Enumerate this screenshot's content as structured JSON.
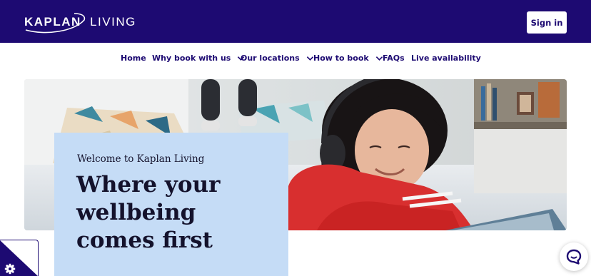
{
  "header": {
    "logo": {
      "primary": "KAPLAN",
      "secondary": "LIVING",
      "icon": "kaplan-swoosh-logo"
    },
    "signin_label": "Sign in"
  },
  "nav": {
    "items": [
      {
        "label": "Home",
        "has_dropdown": false
      },
      {
        "label": "Why book with us",
        "has_dropdown": true
      },
      {
        "label": "Our locations",
        "has_dropdown": true
      },
      {
        "label": "How to book",
        "has_dropdown": true
      },
      {
        "label": "FAQs",
        "has_dropdown": false
      },
      {
        "label": "Live availability",
        "has_dropdown": false
      }
    ],
    "dropdown_icon": "chevron-down-icon"
  },
  "hero": {
    "image": "student-with-headphones-on-bed-photo",
    "card": {
      "subtitle": "Welcome to Kaplan Living",
      "title_lines": [
        "Where your",
        "wellbeing",
        "comes first"
      ]
    }
  },
  "widgets": {
    "cookie_icon": "cookie-settings-gear-icon",
    "chat_icon": "chat-bubble-icon"
  },
  "colors": {
    "brand_navy": "#1d0a72",
    "card_blue": "#c5dcf6",
    "text_dark": "#14122c",
    "white": "#ffffff"
  }
}
